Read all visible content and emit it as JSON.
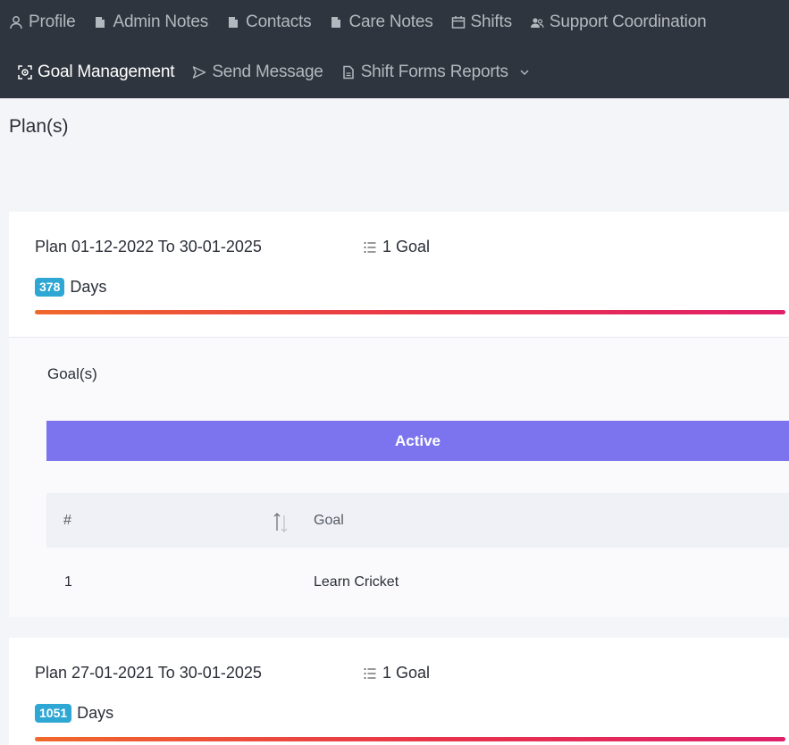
{
  "nav": {
    "row1": [
      {
        "label": "Profile",
        "icon": "user-icon"
      },
      {
        "label": "Admin Notes",
        "icon": "note-icon"
      },
      {
        "label": "Contacts",
        "icon": "note-icon"
      },
      {
        "label": "Care Notes",
        "icon": "note-icon"
      },
      {
        "label": "Shifts",
        "icon": "calendar-icon"
      },
      {
        "label": "Support Coordination",
        "icon": "users-icon"
      }
    ],
    "row2": [
      {
        "label": "Goal Management",
        "icon": "target-icon",
        "active": true
      },
      {
        "label": "Send Message",
        "icon": "send-icon"
      },
      {
        "label": "Shift Forms Reports",
        "icon": "file-icon",
        "dropdown": true
      }
    ]
  },
  "page": {
    "title": "Plan(s)"
  },
  "plans": [
    {
      "title": "Plan 01-12-2022 To 30-01-2025",
      "goal_count": "1 Goal",
      "days_value": "378",
      "days_label": "Days",
      "goals": {
        "heading": "Goal(s)",
        "status_tab": "Active",
        "columns": [
          "#",
          "Goal"
        ],
        "rows": [
          {
            "num": "1",
            "goal": "Learn Cricket"
          }
        ]
      }
    },
    {
      "title": "Plan 27-01-2021 To 30-01-2025",
      "goal_count": "1 Goal",
      "days_value": "1051",
      "days_label": "Days"
    }
  ],
  "colors": {
    "nav_bg": "#2f353e",
    "active_tab": "#7b74ee",
    "badge": "#2fa7d4"
  }
}
